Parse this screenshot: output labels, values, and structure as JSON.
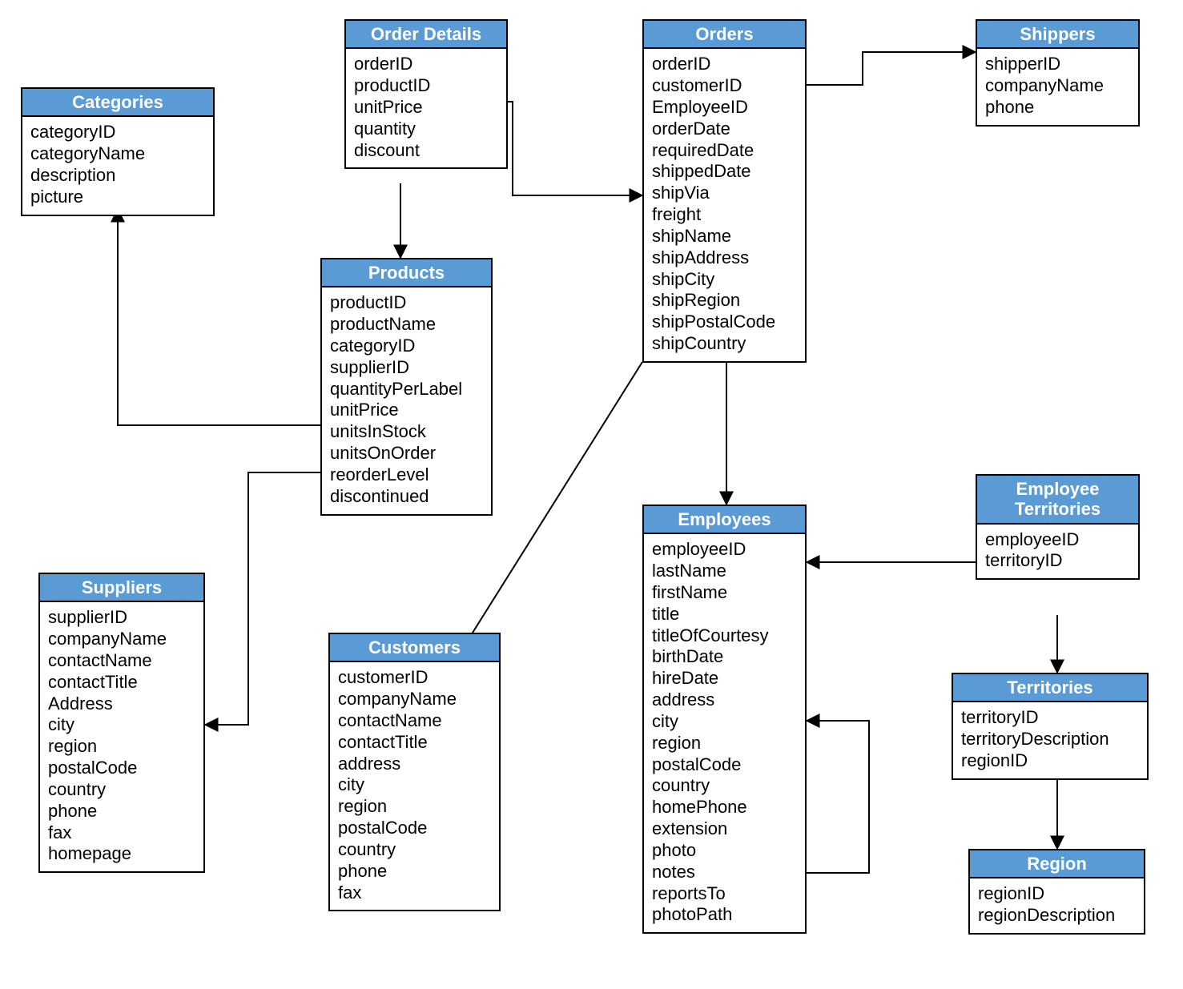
{
  "entities": {
    "categories": {
      "title": "Categories",
      "fields": [
        "categoryID",
        "categoryName",
        "description",
        "picture"
      ]
    },
    "orderDetails": {
      "title": "Order Details",
      "fields": [
        "orderID",
        "productID",
        "unitPrice",
        "quantity",
        "discount"
      ]
    },
    "orders": {
      "title": "Orders",
      "fields": [
        "orderID",
        "customerID",
        "EmployeeID",
        "orderDate",
        "requiredDate",
        "shippedDate",
        "shipVia",
        "freight",
        "shipName",
        "shipAddress",
        "shipCity",
        "shipRegion",
        "shipPostalCode",
        "shipCountry"
      ]
    },
    "shippers": {
      "title": "Shippers",
      "fields": [
        "shipperID",
        "companyName",
        "phone"
      ]
    },
    "products": {
      "title": "Products",
      "fields": [
        "productID",
        "productName",
        "categoryID",
        "supplierID",
        "quantityPerLabel",
        "unitPrice",
        "unitsInStock",
        "unitsOnOrder",
        "reorderLevel",
        "discontinued"
      ]
    },
    "employeeTerritories": {
      "title": "Employee Territories",
      "fields": [
        "employeeID",
        "territoryID"
      ]
    },
    "suppliers": {
      "title": "Suppliers",
      "fields": [
        "supplierID",
        "companyName",
        "contactName",
        "contactTitle",
        "Address",
        "city",
        "region",
        "postalCode",
        "country",
        "phone",
        "fax",
        "homepage"
      ]
    },
    "employees": {
      "title": "Employees",
      "fields": [
        "employeeID",
        "lastName",
        "firstName",
        "title",
        "titleOfCourtesy",
        "birthDate",
        "hireDate",
        "address",
        "city",
        "region",
        "postalCode",
        "country",
        "homePhone",
        "extension",
        "photo",
        "notes",
        "reportsTo",
        "photoPath"
      ]
    },
    "customers": {
      "title": "Customers",
      "fields": [
        "customerID",
        "companyName",
        "contactName",
        "contactTitle",
        "address",
        "city",
        "region",
        "postalCode",
        "country",
        "phone",
        "fax"
      ]
    },
    "territories": {
      "title": "Territories",
      "fields": [
        "territoryID",
        "territoryDescription",
        "regionID"
      ]
    },
    "region": {
      "title": "Region",
      "fields": [
        "regionID",
        "regionDescription"
      ]
    }
  },
  "relationships": [
    {
      "from": "orderDetails",
      "to": "orders"
    },
    {
      "from": "orderDetails",
      "to": "products"
    },
    {
      "from": "products",
      "to": "categories"
    },
    {
      "from": "products",
      "to": "suppliers"
    },
    {
      "from": "orders",
      "to": "shippers"
    },
    {
      "from": "orders",
      "to": "employees"
    },
    {
      "from": "orders",
      "to": "customers"
    },
    {
      "from": "employeeTerritories",
      "to": "employees"
    },
    {
      "from": "employeeTerritories",
      "to": "territories"
    },
    {
      "from": "territories",
      "to": "region"
    },
    {
      "from": "employees",
      "to": "employees",
      "note": "reportsTo self-reference"
    }
  ],
  "colors": {
    "header_bg": "#5b9bd5",
    "header_fg": "#ffffff",
    "border": "#000000",
    "line": "#000000"
  }
}
